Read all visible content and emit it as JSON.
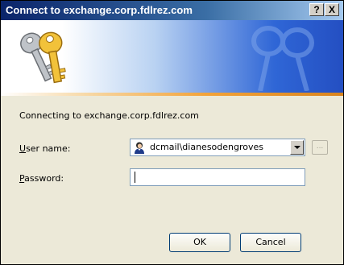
{
  "window": {
    "title": "Connect to exchange.corp.fdlrez.com",
    "help_button": "?",
    "close_button": "X"
  },
  "dialog": {
    "connecting_text": "Connecting to exchange.corp.fdlrez.com",
    "username": {
      "label_prefix": "U",
      "label_rest": "ser name:",
      "value": "dcmail\\dianesodengroves",
      "icon": "user-icon"
    },
    "password": {
      "label_prefix": "P",
      "label_rest": "assword:",
      "value": ""
    },
    "browse_label": "...",
    "buttons": {
      "ok": "OK",
      "cancel": "Cancel"
    }
  },
  "colors": {
    "title_bar_start": "#0a246a",
    "title_bar_end": "#a6caf0",
    "banner_blue": "#2f66d6",
    "banner_stripe": "#f2a33a",
    "dialog_bg": "#ece9d8"
  }
}
